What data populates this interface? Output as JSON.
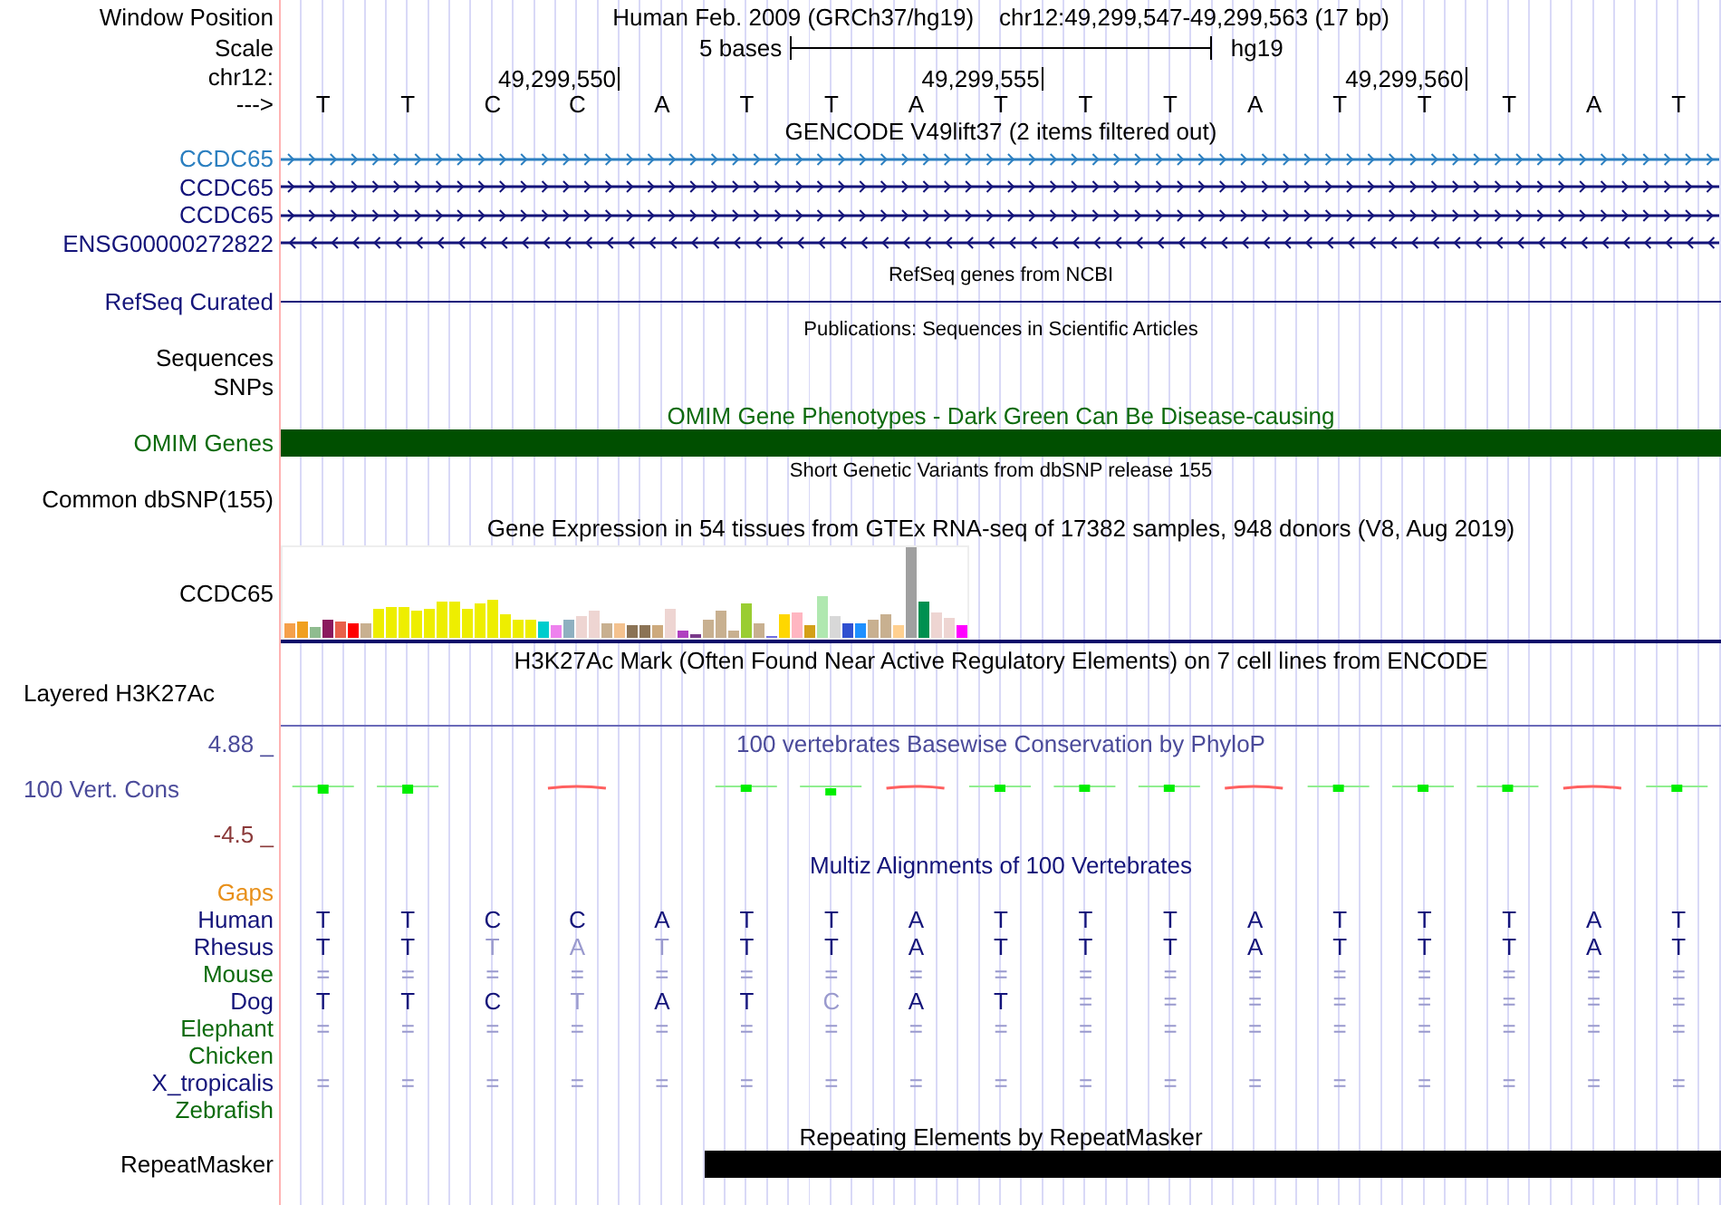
{
  "header": {
    "window_position_label": "Window Position",
    "assembly": "Human Feb. 2009 (GRCh37/hg19)",
    "position": "chr12:49,299,547-49,299,563 (17 bp)",
    "scale_label": "Scale",
    "scale_bar": "5 bases",
    "scale_assembly": "hg19",
    "chrom_label": "chr12:",
    "ruler_labels": [
      "49,299,550",
      "49,299,555",
      "49,299,560"
    ],
    "strand_label": "--->",
    "bases": [
      "T",
      "T",
      "C",
      "C",
      "A",
      "T",
      "T",
      "A",
      "T",
      "T",
      "T",
      "A",
      "T",
      "T",
      "T",
      "A",
      "T"
    ]
  },
  "tracks": [
    {
      "kind": "genes",
      "title": "GENCODE V49lift37 (2 items filtered out)",
      "items": [
        {
          "label": "CCDC65",
          "color": "#2b7fc0",
          "kind": "forward"
        },
        {
          "label": "CCDC65",
          "color": "#14147a",
          "kind": "forward"
        },
        {
          "label": "CCDC65",
          "color": "#14147a",
          "kind": "forward"
        },
        {
          "label": "ENSG00000272822",
          "color": "#14147a",
          "kind": "reverse"
        }
      ]
    },
    {
      "kind": "line",
      "title": "RefSeq genes from NCBI",
      "label": "RefSeq Curated"
    },
    {
      "kind": "labels",
      "title": "Publications: Sequences in Scientific Articles",
      "labels": [
        "Sequences",
        "SNPs"
      ]
    },
    {
      "kind": "bar",
      "title": "OMIM Gene Phenotypes - Dark Green Can Be Disease-causing",
      "label": "OMIM Genes"
    },
    {
      "kind": "labels",
      "title": "Short Genetic Variants from dbSNP release 155",
      "labels": [
        "Common dbSNP(155)"
      ]
    },
    {
      "kind": "expression",
      "title": "Gene Expression in 54 tissues from GTEx RNA-seq of 17382 samples, 948 donors (V8, Aug 2019)",
      "label": "CCDC65"
    },
    {
      "kind": "signal",
      "title": "H3K27Ac Mark (Often Found Near Active Regulatory Elements) on 7 cell lines from ENCODE",
      "label": "Layered H3K27Ac"
    },
    {
      "kind": "conservation",
      "title": "100 vertebrates Basewise Conservation by PhyloP",
      "label": "100 Vert. Cons",
      "max": "4.88 _",
      "min": "-4.5 _"
    },
    {
      "kind": "alignment",
      "title": "Multiz Alignments of 100 Vertebrates",
      "gaps_label": "Gaps",
      "species": [
        {
          "name": "Human",
          "color": "#14147a",
          "cells": [
            {
              "base": "T",
              "faded": false
            },
            {
              "base": "T",
              "faded": false
            },
            {
              "base": "C",
              "faded": false
            },
            {
              "base": "C",
              "faded": false
            },
            {
              "base": "A",
              "faded": false
            },
            {
              "base": "T",
              "faded": false
            },
            {
              "base": "T",
              "faded": false
            },
            {
              "base": "A",
              "faded": false
            },
            {
              "base": "T",
              "faded": false
            },
            {
              "base": "T",
              "faded": false
            },
            {
              "base": "T",
              "faded": false
            },
            {
              "base": "A",
              "faded": false
            },
            {
              "base": "T",
              "faded": false
            },
            {
              "base": "T",
              "faded": false
            },
            {
              "base": "T",
              "faded": false
            },
            {
              "base": "A",
              "faded": false
            },
            {
              "base": "T",
              "faded": false
            }
          ]
        },
        {
          "name": "Rhesus",
          "color": "#14147a",
          "cells": [
            {
              "base": "T",
              "faded": false
            },
            {
              "base": "T",
              "faded": false
            },
            {
              "base": "T",
              "faded": true
            },
            {
              "base": "A",
              "faded": true
            },
            {
              "base": "T",
              "faded": true
            },
            {
              "base": "T",
              "faded": false
            },
            {
              "base": "T",
              "faded": false
            },
            {
              "base": "A",
              "faded": false
            },
            {
              "base": "T",
              "faded": false
            },
            {
              "base": "T",
              "faded": false
            },
            {
              "base": "T",
              "faded": false
            },
            {
              "base": "A",
              "faded": false
            },
            {
              "base": "T",
              "faded": false
            },
            {
              "base": "T",
              "faded": false
            },
            {
              "base": "T",
              "faded": false
            },
            {
              "base": "A",
              "faded": false
            },
            {
              "base": "T",
              "faded": false
            }
          ]
        },
        {
          "name": "Mouse",
          "color": "#0d6b0d",
          "cells": [
            {
              "base": "=",
              "faded": true
            },
            {
              "base": "=",
              "faded": true
            },
            {
              "base": "=",
              "faded": true
            },
            {
              "base": "=",
              "faded": true
            },
            {
              "base": "=",
              "faded": true
            },
            {
              "base": "=",
              "faded": true
            },
            {
              "base": "=",
              "faded": true
            },
            {
              "base": "=",
              "faded": true
            },
            {
              "base": "=",
              "faded": true
            },
            {
              "base": "=",
              "faded": true
            },
            {
              "base": "=",
              "faded": true
            },
            {
              "base": "=",
              "faded": true
            },
            {
              "base": "=",
              "faded": true
            },
            {
              "base": "=",
              "faded": true
            },
            {
              "base": "=",
              "faded": true
            },
            {
              "base": "=",
              "faded": true
            },
            {
              "base": "=",
              "faded": true
            }
          ]
        },
        {
          "name": "Dog",
          "color": "#14147a",
          "cells": [
            {
              "base": "T",
              "faded": false
            },
            {
              "base": "T",
              "faded": false
            },
            {
              "base": "C",
              "faded": false
            },
            {
              "base": "T",
              "faded": true
            },
            {
              "base": "A",
              "faded": false
            },
            {
              "base": "T",
              "faded": false
            },
            {
              "base": "C",
              "faded": true
            },
            {
              "base": "A",
              "faded": false
            },
            {
              "base": "T",
              "faded": false
            },
            {
              "base": "=",
              "faded": true
            },
            {
              "base": "=",
              "faded": true
            },
            {
              "base": "=",
              "faded": true
            },
            {
              "base": "=",
              "faded": true
            },
            {
              "base": "=",
              "faded": true
            },
            {
              "base": "=",
              "faded": true
            },
            {
              "base": "=",
              "faded": true
            },
            {
              "base": "=",
              "faded": true
            }
          ]
        },
        {
          "name": "Elephant",
          "color": "#0d6b0d",
          "cells": [
            {
              "base": "=",
              "faded": true
            },
            {
              "base": "=",
              "faded": true
            },
            {
              "base": "=",
              "faded": true
            },
            {
              "base": "=",
              "faded": true
            },
            {
              "base": "=",
              "faded": true
            },
            {
              "base": "=",
              "faded": true
            },
            {
              "base": "=",
              "faded": true
            },
            {
              "base": "=",
              "faded": true
            },
            {
              "base": "=",
              "faded": true
            },
            {
              "base": "=",
              "faded": true
            },
            {
              "base": "=",
              "faded": true
            },
            {
              "base": "=",
              "faded": true
            },
            {
              "base": "=",
              "faded": true
            },
            {
              "base": "=",
              "faded": true
            },
            {
              "base": "=",
              "faded": true
            },
            {
              "base": "=",
              "faded": true
            },
            {
              "base": "=",
              "faded": true
            }
          ]
        },
        {
          "name": "Chicken",
          "color": "#0d6b0d"
        },
        {
          "name": "X_tropicalis",
          "color": "#14147a",
          "cells": [
            {
              "base": "=",
              "faded": true
            },
            {
              "base": "=",
              "faded": true
            },
            {
              "base": "=",
              "faded": true
            },
            {
              "base": "=",
              "faded": true
            },
            {
              "base": "=",
              "faded": true
            },
            {
              "base": "=",
              "faded": true
            },
            {
              "base": "=",
              "faded": true
            },
            {
              "base": "=",
              "faded": true
            },
            {
              "base": "=",
              "faded": true
            },
            {
              "base": "=",
              "faded": true
            },
            {
              "base": "=",
              "faded": true
            },
            {
              "base": "=",
              "faded": true
            },
            {
              "base": "=",
              "faded": true
            },
            {
              "base": "=",
              "faded": true
            },
            {
              "base": "=",
              "faded": true
            },
            {
              "base": "=",
              "faded": true
            },
            {
              "base": "=",
              "faded": true
            }
          ]
        },
        {
          "name": "Zebrafish",
          "color": "#0d6b0d"
        }
      ]
    },
    {
      "kind": "repeat",
      "title": "Repeating Elements by RepeatMasker",
      "label": "RepeatMasker"
    }
  ]
}
